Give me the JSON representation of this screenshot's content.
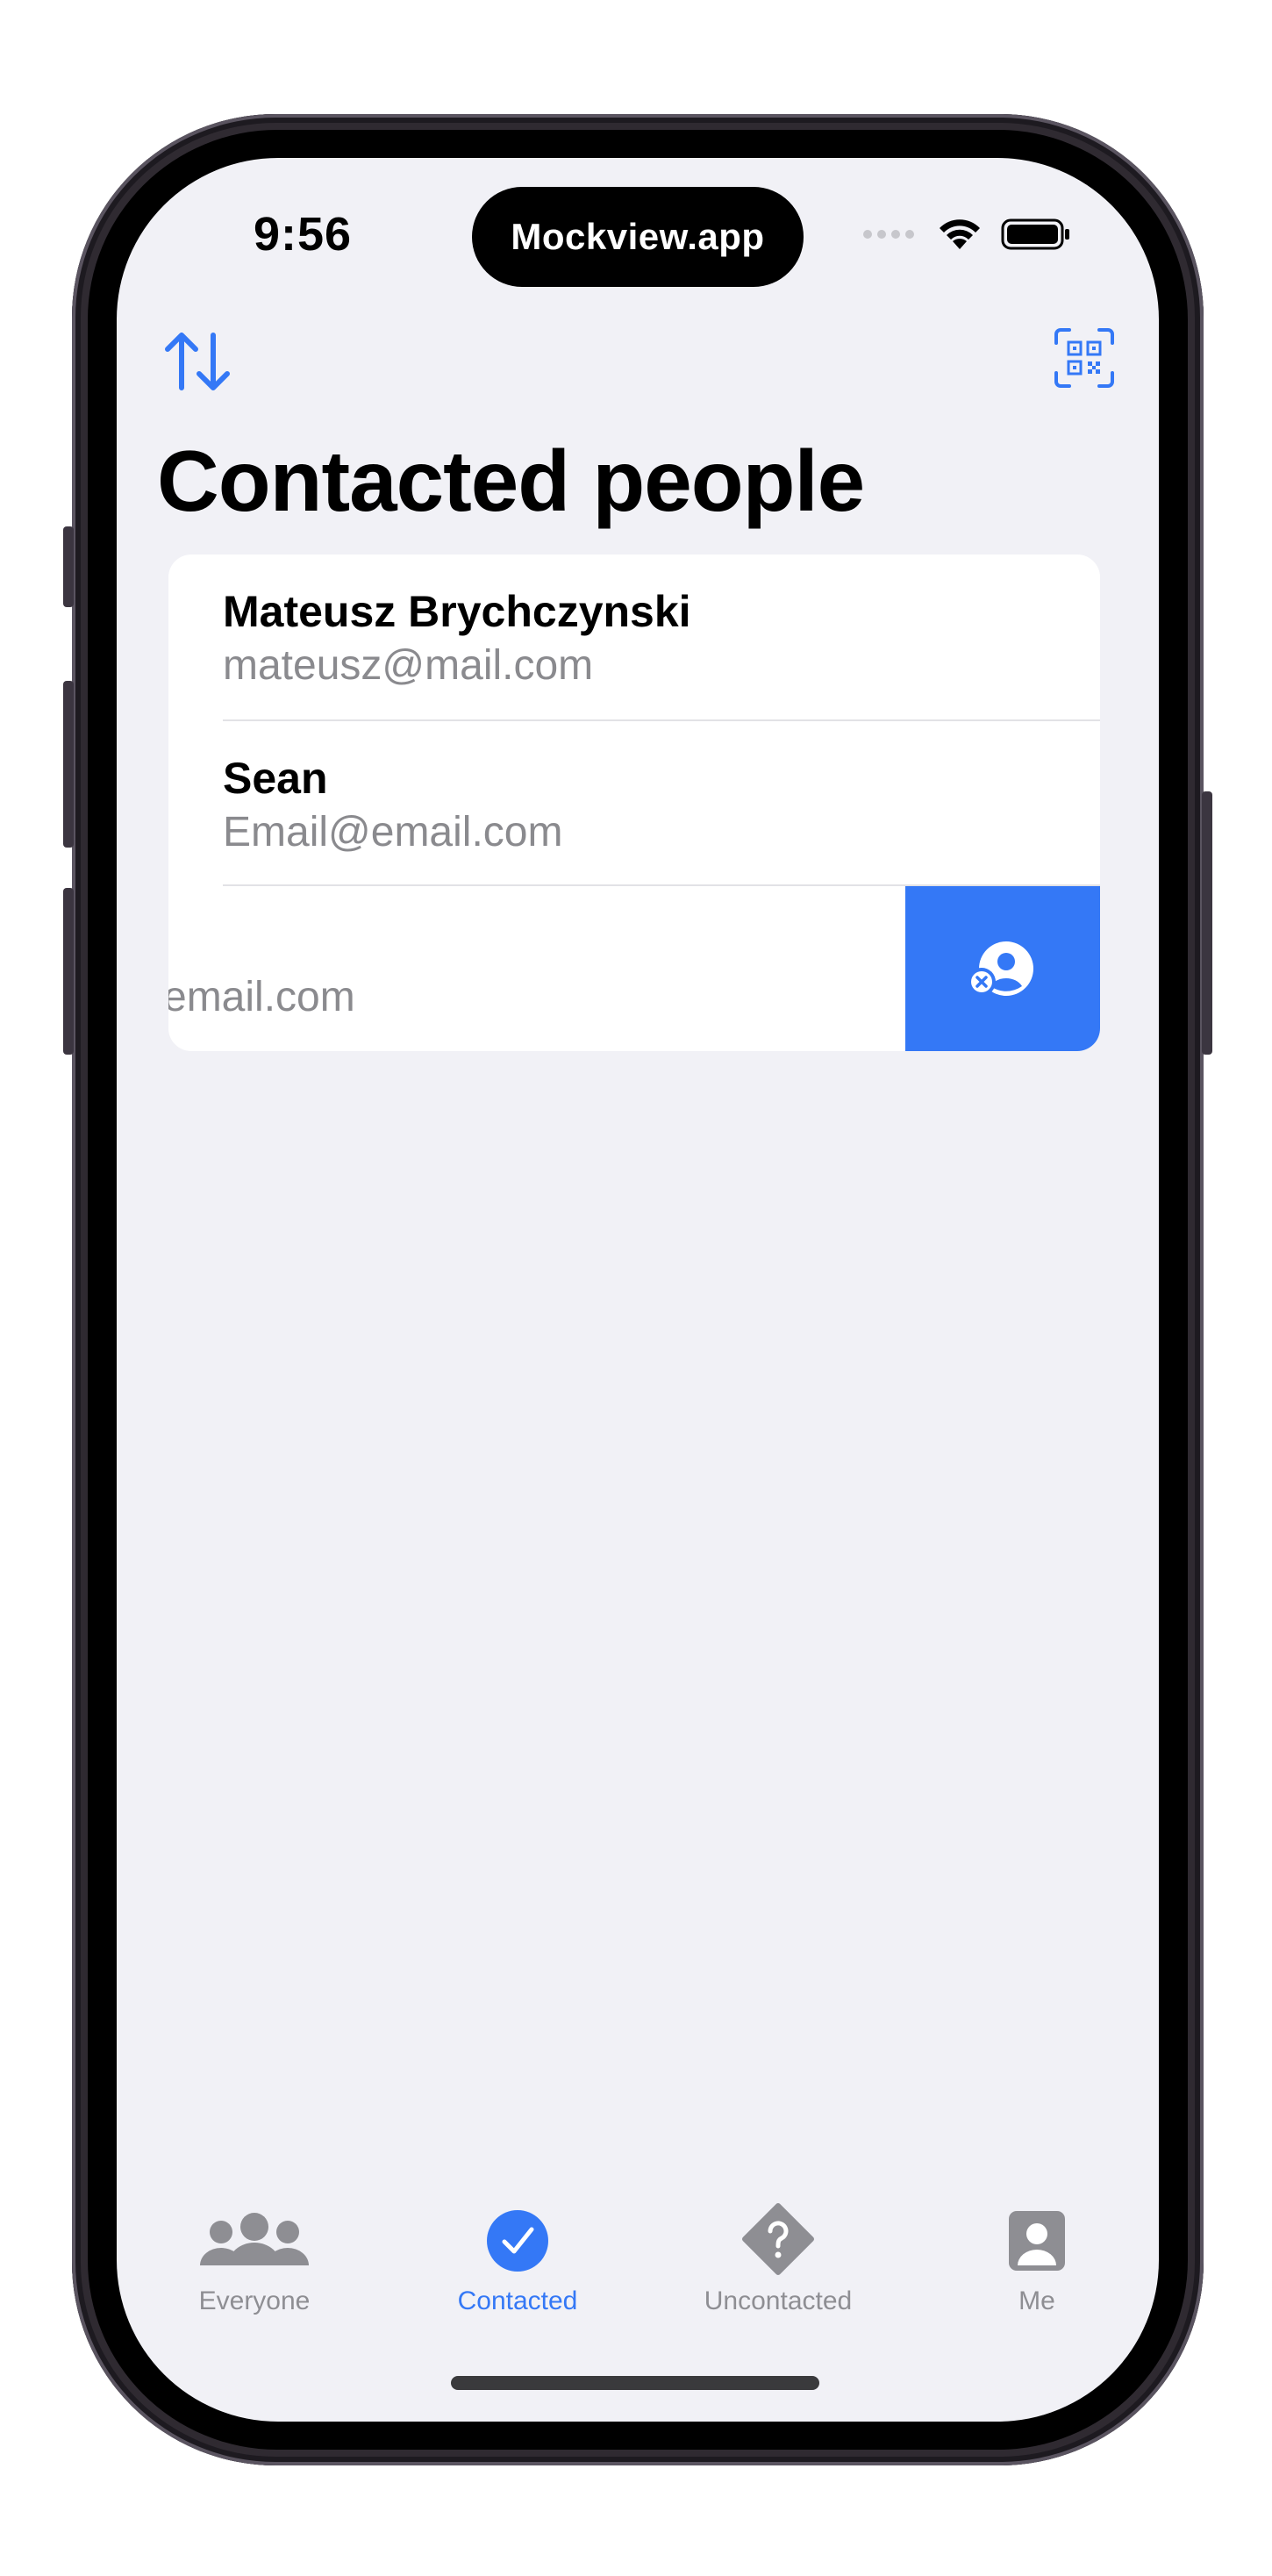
{
  "status_bar": {
    "time": "9:56",
    "island_label": "Mockview.app"
  },
  "nav": {
    "sort_icon": "arrow-up-down-icon",
    "scan_icon": "qr-code-scan-icon"
  },
  "page": {
    "title": "Contacted people"
  },
  "contacts": [
    {
      "name": "Mateusz Brychczynski",
      "email": "mateusz@mail.com"
    },
    {
      "name": "Sean",
      "email": "Email@email.com"
    },
    {
      "name": "",
      "email": "email.com"
    }
  ],
  "swipe_action": {
    "icon": "person-remove-icon",
    "color": "#3478f6"
  },
  "tabs": [
    {
      "label": "Everyone",
      "icon": "people-group-icon",
      "active": false
    },
    {
      "label": "Contacted",
      "icon": "checkmark-circle-icon",
      "active": true
    },
    {
      "label": "Uncontacted",
      "icon": "question-diamond-icon",
      "active": false
    },
    {
      "label": "Me",
      "icon": "person-square-icon",
      "active": false
    }
  ],
  "colors": {
    "accent": "#3478f6",
    "background": "#f1f1f6",
    "secondary_text": "#8a8a8e",
    "inactive_tab": "#8e8e93"
  }
}
